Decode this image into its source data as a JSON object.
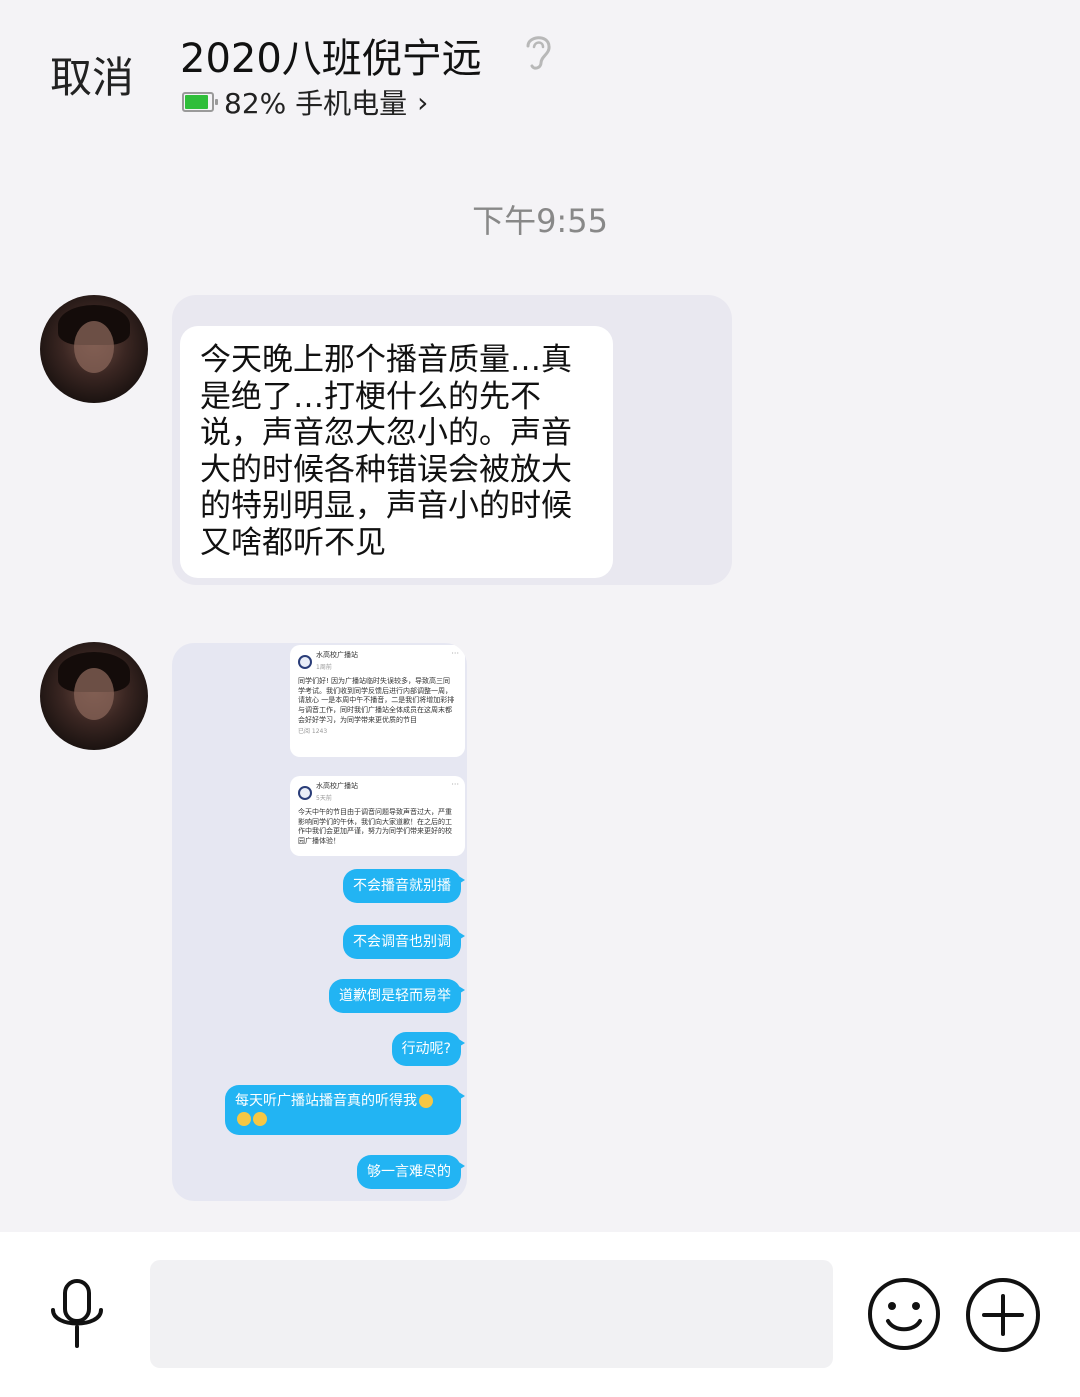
{
  "header": {
    "cancel_label": "取消",
    "title": "2020八班倪宁远",
    "battery_text": "82% 手机电量",
    "battery_level": 0.82,
    "chevron": "›",
    "ear_icon": "ear-icon"
  },
  "timestamp": "下午9:55",
  "messages": [
    {
      "type": "text",
      "text": "今天晚上那个播音质量…真是绝了…打梗什么的先不说，声音忽大忽小的。声音大的时候各种错误会被放大的特别明显，声音小的时候又啥都听不见"
    },
    {
      "type": "image",
      "posts": [
        {
          "name": "水高校广播站",
          "date": "1周前",
          "body": "同学们好! 因为广播站临时失误较多，导致高三同学考试。我们收到同学反馈后进行内部调整一周，请放心 一是本周中午不播音，二是我们将增加彩排与调音工作，同时我们广播站全体成员在这周末都会好好学习，为同学带来更优质的节目",
          "footer": "已阅 1243"
        },
        {
          "name": "水高校广播站",
          "date": "5天前",
          "body": "今天中午的节目由于调音问题导致声音过大，严重影响同学们的午休，我们向大家道歉！在之后的工作中我们会更加严谨，努力为同学们带来更好的校园广播体验！"
        }
      ],
      "replies": [
        "不会播音就别播",
        "不会调音也别调",
        "道歉倒是轻而易举",
        "行动呢?",
        "每天听广播站播音真的听得我",
        "够一言难尽的"
      ]
    }
  ],
  "bottom_bar": {
    "mic_icon": "microphone-icon",
    "input_value": "",
    "emoji_icon": "smile-icon",
    "plus_icon": "plus-icon"
  }
}
